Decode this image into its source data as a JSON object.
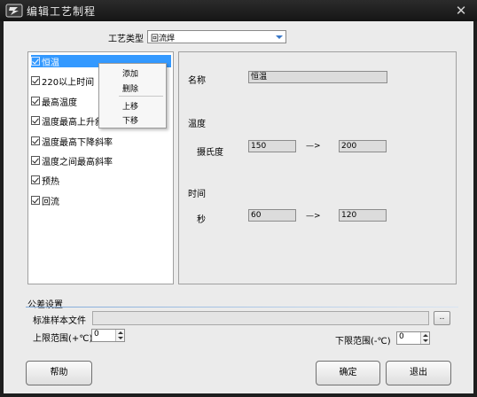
{
  "window": {
    "title": "编辑工艺制程",
    "close_glyph": "✕"
  },
  "process_type": {
    "label": "工艺类型",
    "value": "回流焊"
  },
  "steps": [
    {
      "label": "恒温",
      "checked": true,
      "selected": true
    },
    {
      "label": "220以上时间",
      "checked": true
    },
    {
      "label": "最高温度",
      "checked": true
    },
    {
      "label": "温度最高上升斜",
      "checked": true
    },
    {
      "label": "温度最高下降斜率",
      "checked": true
    },
    {
      "label": "温度之间最高斜率",
      "checked": true
    },
    {
      "label": "预热",
      "checked": true
    },
    {
      "label": "回流",
      "checked": true
    }
  ],
  "context_menu": {
    "add": "添加",
    "delete": "删除",
    "move_up": "上移",
    "move_down": "下移"
  },
  "detail": {
    "name_label": "名称",
    "name_value": "恒温",
    "temp_label": "温度",
    "temp_unit": "摄氏度",
    "temp_from": "150",
    "temp_to": "200",
    "arrow": "—>",
    "time_label": "时间",
    "time_unit": "秒",
    "time_from": "60",
    "time_to": "120"
  },
  "tolerance": {
    "title": "公差设置",
    "file_label": "标准样本文件",
    "file_value": "",
    "browse": "..",
    "upper_label": "上限范围(+℃)",
    "upper_value": "0",
    "lower_label": "下限范围(-℃)",
    "lower_value": "0"
  },
  "buttons": {
    "help": "帮助",
    "ok": "确定",
    "exit": "退出"
  }
}
